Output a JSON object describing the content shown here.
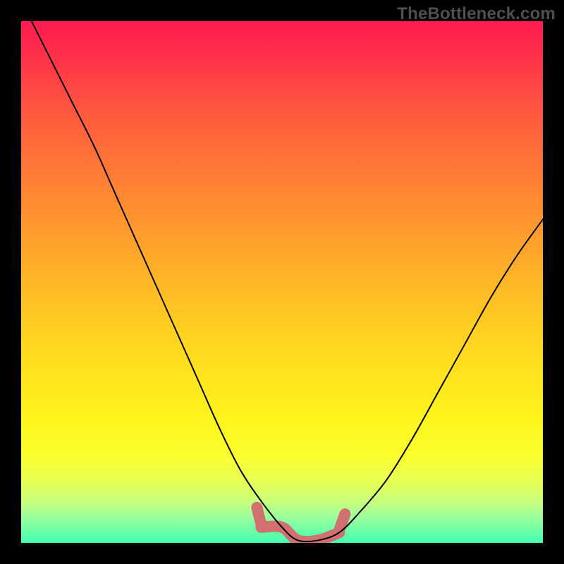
{
  "watermark": "TheBottleneck.com",
  "chart_data": {
    "type": "line",
    "title": "",
    "xlabel": "",
    "ylabel": "",
    "xlim": [
      0,
      100
    ],
    "ylim": [
      0,
      100
    ],
    "series": [
      {
        "name": "bottleneck-curve",
        "x": [
          2,
          6,
          10,
          14,
          18,
          22,
          26,
          30,
          34,
          38,
          42,
          46,
          50,
          53,
          57,
          61,
          65,
          70,
          75,
          80,
          85,
          90,
          95,
          100
        ],
        "y": [
          100,
          92,
          84,
          76,
          67,
          58,
          49,
          40,
          31,
          22,
          14,
          8,
          3,
          0.5,
          0.5,
          2,
          6,
          12,
          20,
          29,
          38,
          47,
          55,
          62
        ]
      }
    ],
    "annotations": [
      {
        "name": "optimal-band",
        "x_start": 46,
        "x_end": 61,
        "color": "#d07070"
      }
    ],
    "background_gradient": {
      "stops": [
        {
          "pos": 0.0,
          "color": "#ff1a52"
        },
        {
          "pos": 0.5,
          "color": "#ffc224"
        },
        {
          "pos": 0.85,
          "color": "#fbff2d"
        },
        {
          "pos": 1.0,
          "color": "#42ffb0"
        }
      ],
      "meaning": "top = worst (red), bottom = best (green)"
    }
  }
}
